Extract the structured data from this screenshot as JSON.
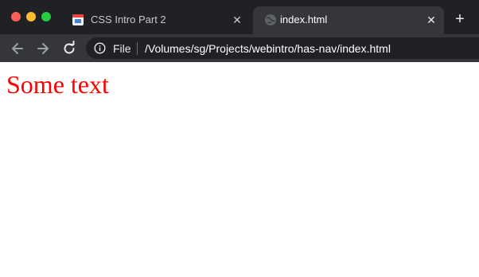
{
  "tabs": [
    {
      "title": "CSS Intro Part 2",
      "active": false,
      "favicon": "slides-icon"
    },
    {
      "title": "index.html",
      "active": true,
      "favicon": "globe-icon"
    }
  ],
  "address_bar": {
    "scheme_label": "File",
    "url": "/Volumes/sg/Projects/webintro/has-nav/index.html"
  },
  "page": {
    "text": "Some text",
    "text_color": "#ff0000"
  },
  "colors": {
    "titlebar": "#202124",
    "toolbar": "#35363a",
    "close_dot": "#fe5f57",
    "minimize_dot": "#febc2e",
    "maximize_dot": "#28c840"
  }
}
